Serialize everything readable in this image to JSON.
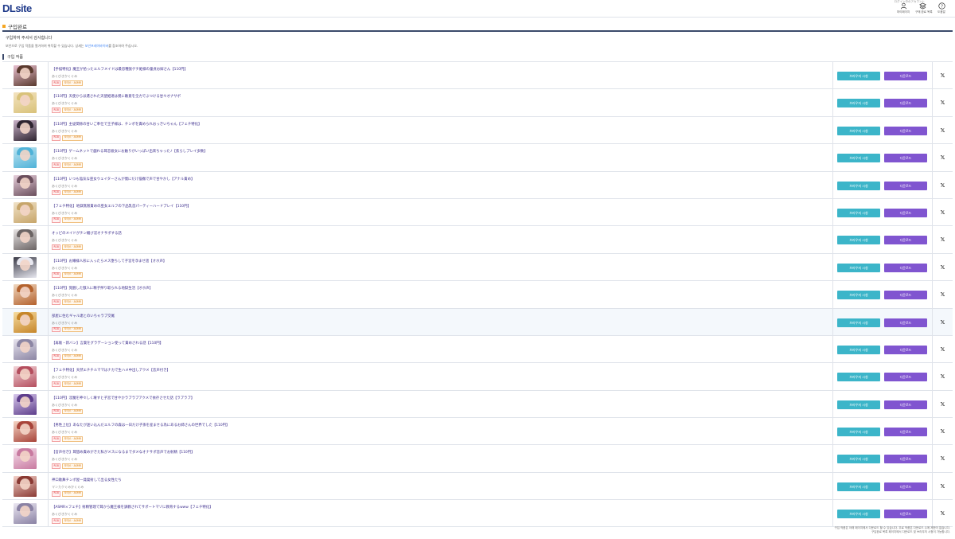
{
  "header": {
    "logo": "DLsite",
    "top_note": "ログイン中のアカウント",
    "menu": [
      {
        "label": "마이페이지",
        "icon": "user-icon"
      },
      {
        "label": "구매 완료 목록",
        "icon": "stack-icon"
      },
      {
        "label": "도움말",
        "icon": "help-icon"
      }
    ]
  },
  "page_title": "구입완료",
  "thanks": "구입하여 주셔서 감사합니다",
  "notice": {
    "text": "보안으로 구입 작품을 열거하여 취득할 수 있습니다. 상세는",
    "link": "보안프레이바이버",
    "after": "를 참조하여 주십시오."
  },
  "section_title": "구입 작품",
  "buttons": {
    "browser": "브라우저 시청",
    "download": "다운로드"
  },
  "tags": {
    "rating": "R18",
    "category": "보이스 · ASMR"
  },
  "colors": {
    "browser_button": "#3cb5c9",
    "download_button": "#8055d0",
    "title_link": "#3b2c8c"
  },
  "items": [
    {
      "title": "【手描特化】魔王が拾ったエルフメイドは最恐種族ゲチ姫様の童貞お嫁さん【110円】",
      "circle": "あくびきかくぐみ",
      "c1": "#e8c0d0",
      "c2": "#5a3a2e"
    },
    {
      "title": "【110円】天使から派遣された天使姫達は僕に敵意を全力でぶつける甘々オナサポ",
      "circle": "あくびきかくぐみ",
      "c1": "#f3e3c0",
      "c2": "#d9c27a"
    },
    {
      "title": "【110円】主従関係の甘いご奉仕で王子様は、チンポを責められおっきいちゃん【フェチ特化】",
      "circle": "あくびきかくぐみ",
      "c1": "#c9b2c8",
      "c2": "#2e2430"
    },
    {
      "title": "【110円】ゲームネットで戯れる耳恋彼女にお触りがいっぱい出来ちゃった♪【焦らしプレイ多数】",
      "circle": "あくびきかくぐみ",
      "c1": "#bfe4f0",
      "c2": "#4fb2d8"
    },
    {
      "title": "【110円】いつも陰気な巫女ウェイターさんが僕にだけ猫撫で声で甘やかし【アナル責め】",
      "circle": "あくびきかくぐみ",
      "c1": "#e8d0dc",
      "c2": "#6a4e5c"
    },
    {
      "title": "【フェチ特化】地獄無限責めの巫女エルフの下品乳首パーティーハードプレイ【110円】",
      "circle": "あくびきかくぐみ",
      "c1": "#f0e2c8",
      "c2": "#c7a56a"
    },
    {
      "title": "オッピのメイドがチン媚び淫オナサポする話",
      "circle": "あくびきかくぐみ",
      "c1": "#e8e4e4",
      "c2": "#6b6464"
    },
    {
      "title": "【110円】お嬢様人形に入ったらメス堕ちして子宮を孕ませ話【オホ声】",
      "circle": "あくびきかくぐみ",
      "c1": "#3a3a46",
      "c2": "#e8e8f0"
    },
    {
      "title": "【110円】覚醒した獣人に精子搾り取られる地獄生活【オホ声】",
      "circle": "あくびきかくぐみ",
      "c1": "#f0d8c0",
      "c2": "#b4622e"
    },
    {
      "title": "部屋に住むギャル達とのいちゃラブ交尾",
      "circle": "あくびきかくぐみ",
      "c1": "#f6dca0",
      "c2": "#c6862a"
    },
    {
      "title": "【再販・新バン】言葉をグラデーション使って責めされる話【110円】",
      "circle": "あくびきかくぐみ",
      "c1": "#e8e4ee",
      "c2": "#8c86a4"
    },
    {
      "title": "【フェチ特化】天然エチチルママはナカで生ハメ中出しアクメ【音声付き】",
      "circle": "あくびきかくぐみ",
      "c1": "#f2d4d8",
      "c2": "#b44e5e"
    },
    {
      "title": "【110円】淫魔を神々しく壊すと子宮で甘やかラブラブアクメで依存させた話【ラブラブ】",
      "circle": "あくびきかくぐみ",
      "c1": "#d8c8ec",
      "c2": "#5e3e8c"
    },
    {
      "title": "【男性上位】あなたが迷い込んだエルフの森は一日だけ子孫を産ませる為にあるお姉さんの世界でした【110円】",
      "circle": "あくびきかくぐみ",
      "c1": "#f4d4c4",
      "c2": "#a8443a"
    },
    {
      "title": "【音声付き】耳舐め責めがきた私がメスになるまでダメなオナサポ音声でお射精【110円】",
      "circle": "あくびきかくぐみ",
      "c1": "#f6e0ec",
      "c2": "#c87aa0"
    },
    {
      "title": "神口歌舞チンポ屋一発発射して出る女性たち",
      "circle": "マンカクぐみかくぐみ",
      "c1": "#f4d0c8",
      "c2": "#8a3a34"
    },
    {
      "title": "【ASMR×フェチ】射精管理で耳から魔王様を調教されてサポートマゾに教育するwww【フェチ特化】",
      "circle": "あくびきかくぐみ",
      "c1": "#ece8f2",
      "c2": "#8a82a4"
    }
  ],
  "footer": [
    "구입 작품은 아래 페이지에서 다운로드 할 수 있습니다. 무료 작품은 다운로드 수에 제한이 없습니다.",
    "구입완료 목록 페이지에서 다운로드 및 브라우저 시청이 가능합니다."
  ]
}
